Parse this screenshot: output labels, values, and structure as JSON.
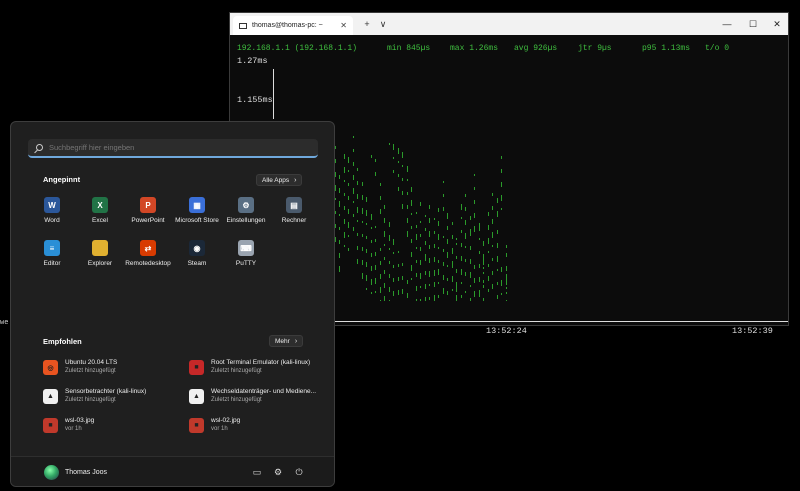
{
  "terminal": {
    "tab_title": "thomas@thomas-pc: ~",
    "new_tab": "+",
    "dropdown": "∨",
    "minimize": "—",
    "maximize": "☐",
    "close": "✕",
    "stats": {
      "host": "192.168.1.1 (192.168.1.1)",
      "min": "min 845µs",
      "max": "max 1.26ms",
      "avg": "avg 926µs",
      "jtr": "jtr 9µs",
      "p95": "p95 1.13ms",
      "timeout": "t/o 0"
    },
    "y_labels": [
      "1.27ms",
      "1.155ms"
    ],
    "time_labels": [
      "13:52:24",
      "13:52:39"
    ]
  },
  "start_menu": {
    "search_placeholder": "Suchbegriff hier eingeben",
    "pinned_title": "Angepinnt",
    "all_apps_label": "Alle Apps",
    "pinned_apps": [
      {
        "label": "Word",
        "icon": "word-icon",
        "color": "#2b579a",
        "glyph": "W"
      },
      {
        "label": "Excel",
        "icon": "excel-icon",
        "color": "#217346",
        "glyph": "X"
      },
      {
        "label": "PowerPoint",
        "icon": "powerpoint-icon",
        "color": "#d24726",
        "glyph": "P"
      },
      {
        "label": "Microsoft Store",
        "icon": "store-icon",
        "color": "#3a6fd8",
        "glyph": "▦"
      },
      {
        "label": "Einstellungen",
        "icon": "settings-icon",
        "color": "#5a6f84",
        "glyph": "⚙"
      },
      {
        "label": "Rechner",
        "icon": "calculator-icon",
        "color": "#4a5a6c",
        "glyph": "▤"
      },
      {
        "label": "Editor",
        "icon": "notepad-icon",
        "color": "#2a8fd6",
        "glyph": "≡"
      },
      {
        "label": "Explorer",
        "icon": "explorer-icon",
        "color": "#e0b030",
        "glyph": ""
      },
      {
        "label": "Remotedesktop",
        "icon": "remote-desktop-icon",
        "color": "#d83b01",
        "glyph": "⇄"
      },
      {
        "label": "Steam",
        "icon": "steam-icon",
        "color": "#1b2838",
        "glyph": "◉"
      },
      {
        "label": "PuTTY",
        "icon": "putty-icon",
        "color": "#9aa4b0",
        "glyph": "⌨"
      }
    ],
    "recommended_title": "Empfohlen",
    "more_label": "Mehr",
    "recommended": [
      {
        "name": "Ubuntu 20.04 LTS",
        "sub": "Zuletzt hinzugefügt",
        "icon": "ubuntu-icon",
        "color": "#e95420"
      },
      {
        "name": "Root Terminal Emulator (kali-linux)",
        "sub": "Zuletzt hinzugefügt",
        "icon": "root-terminal-icon",
        "color": "#c62828"
      },
      {
        "name": "Sensorbetrachter (kali-linux)",
        "sub": "Zuletzt hinzugefügt",
        "icon": "linux-penguin-icon",
        "color": "#f0f0f0"
      },
      {
        "name": "Wechseldatenträger- und Mediene...",
        "sub": "Zuletzt hinzugefügt",
        "icon": "linux-penguin-icon",
        "color": "#f0f0f0"
      },
      {
        "name": "wsl-03.jpg",
        "sub": "vor 1h",
        "icon": "image-file-icon",
        "color": "#c0392b"
      },
      {
        "name": "wsl-02.jpg",
        "sub": "vor 1h",
        "icon": "image-file-icon",
        "color": "#c0392b"
      }
    ],
    "user_name": "Thomas Joos"
  },
  "background_text": "we"
}
